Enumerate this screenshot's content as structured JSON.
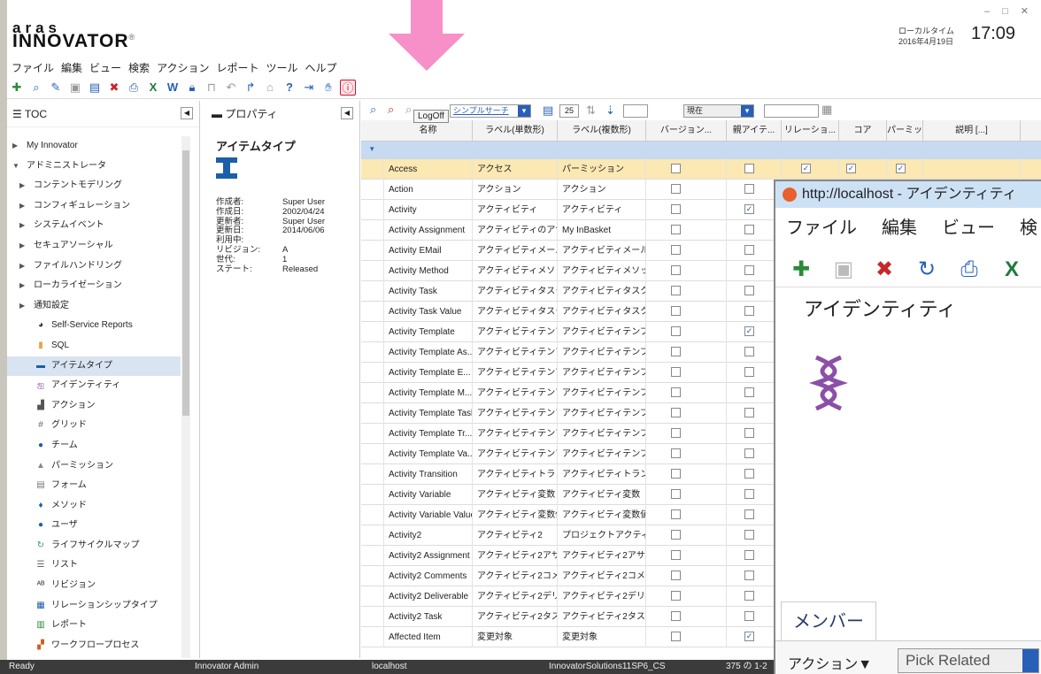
{
  "app": {
    "logo_top": "aras",
    "logo_main": "INNOVATOR",
    "logo_mark": "®",
    "local_time_label": "ローカルタイム",
    "date": "2016年4月19日",
    "time": "17:09",
    "window_controls": [
      "–",
      "□",
      "✕"
    ]
  },
  "menu": [
    "ファイル",
    "編集",
    "ビュー",
    "検索",
    "アクション",
    "レポート",
    "ツール",
    "ヘルプ"
  ],
  "tooltip": "LogOff",
  "toc": {
    "title": "TOC",
    "items": [
      {
        "label": "My Innovator",
        "level": 0,
        "caret": "▶"
      },
      {
        "label": "アドミニストレータ",
        "level": 0,
        "caret": "▼"
      },
      {
        "label": "コンテントモデリング",
        "level": 1,
        "caret": "▶"
      },
      {
        "label": "コンフィギュレーション",
        "level": 1,
        "caret": "▶"
      },
      {
        "label": "システムイベント",
        "level": 1,
        "caret": "▶"
      },
      {
        "label": "セキュアソーシャル",
        "level": 1,
        "caret": "▶"
      },
      {
        "label": "ファイルハンドリング",
        "level": 1,
        "caret": "▶"
      },
      {
        "label": "ローカライゼーション",
        "level": 1,
        "caret": "▶"
      },
      {
        "label": "通知設定",
        "level": 1,
        "caret": "▶"
      },
      {
        "label": "Self-Service Reports",
        "level": 2,
        "icon": "reports-icon",
        "glyph": "◕",
        "color": "#333"
      },
      {
        "label": "SQL",
        "level": 2,
        "icon": "sql-icon",
        "glyph": "▮",
        "color": "#e8a040"
      },
      {
        "label": "アイテムタイプ",
        "level": 2,
        "icon": "itemtype-icon",
        "glyph": "▬",
        "color": "#1b5fa8",
        "selected": true
      },
      {
        "label": "アイデンティティ",
        "level": 2,
        "icon": "dna-icon",
        "glyph": "ஐ",
        "color": "#8b4fa8"
      },
      {
        "label": "アクション",
        "level": 2,
        "icon": "action-icon",
        "glyph": "▟",
        "color": "#555"
      },
      {
        "label": "グリッド",
        "level": 2,
        "icon": "grid-icon",
        "glyph": "#",
        "color": "#666"
      },
      {
        "label": "チーム",
        "level": 2,
        "icon": "team-icon",
        "glyph": "●",
        "color": "#1b5fa8"
      },
      {
        "label": "パーミッション",
        "level": 2,
        "icon": "permission-icon",
        "glyph": "▲",
        "color": "#888"
      },
      {
        "label": "フォーム",
        "level": 2,
        "icon": "form-icon",
        "glyph": "▤",
        "color": "#777"
      },
      {
        "label": "メソッド",
        "level": 2,
        "icon": "method-icon",
        "glyph": "♦",
        "color": "#1b5fa8"
      },
      {
        "label": "ユーザ",
        "level": 2,
        "icon": "user-icon",
        "glyph": "●",
        "color": "#1b5fa8"
      },
      {
        "label": "ライフサイクルマップ",
        "level": 2,
        "icon": "lifecycle-icon",
        "glyph": "↻",
        "color": "#3a9a6a"
      },
      {
        "label": "リスト",
        "level": 2,
        "icon": "list-icon",
        "glyph": "☰",
        "color": "#666"
      },
      {
        "label": "リビジョン",
        "level": 2,
        "icon": "revision-icon",
        "glyph": "ᴬᴮ",
        "color": "#333"
      },
      {
        "label": "リレーションシップタイプ",
        "level": 2,
        "icon": "relationship-icon",
        "glyph": "▦",
        "color": "#1b5fa8"
      },
      {
        "label": "レポート",
        "level": 2,
        "icon": "report-icon",
        "glyph": "▥",
        "color": "#2a8a3a"
      },
      {
        "label": "ワークフロープロセス",
        "level": 2,
        "icon": "workflow-icon",
        "glyph": "▞",
        "color": "#d06020"
      }
    ]
  },
  "props": {
    "title": "プロパティ",
    "item_title": "アイテムタイプ",
    "fields": [
      {
        "k": "作成者:",
        "v": "Super User"
      },
      {
        "k": "作成日:",
        "v": "2002/04/24"
      },
      {
        "k": "更新者:",
        "v": "Super User"
      },
      {
        "k": "更新日:",
        "v": "2014/06/06"
      },
      {
        "k": "利用中:",
        "v": ""
      },
      {
        "k": "リビジョン:",
        "v": "A"
      },
      {
        "k": "世代:",
        "v": "1"
      },
      {
        "k": "ステート:",
        "v": "Released"
      }
    ]
  },
  "grid_tools": {
    "search_mode": "シンプルサーチ",
    "page_size": "25",
    "version_mode": "現在"
  },
  "columns": [
    "名称",
    "ラベル(単数形)",
    "ラベル(複数形)",
    "バージョン...",
    "親アイテ...",
    "リレーショ...",
    "コア",
    "パーミッショ...",
    "説明 [...]"
  ],
  "rows": [
    {
      "name": "Access",
      "single": "アクセス",
      "plural": "パーミッション",
      "c": [
        0,
        0,
        1,
        1,
        1
      ],
      "hl": true
    },
    {
      "name": "Action",
      "single": "アクション",
      "plural": "アクション",
      "c": [
        0,
        0,
        0,
        0,
        0
      ]
    },
    {
      "name": "Activity",
      "single": "アクティビティ",
      "plural": "アクティビティ",
      "c": [
        0,
        1,
        0,
        0,
        0
      ]
    },
    {
      "name": "Activity Assignment",
      "single": "アクティビティのアサ...",
      "plural": "My InBasket",
      "c": [
        0,
        0,
        0,
        0,
        0
      ]
    },
    {
      "name": "Activity EMail",
      "single": "アクティビティメール",
      "plural": "アクティビティメール",
      "c": [
        0,
        0,
        0,
        0,
        0
      ]
    },
    {
      "name": "Activity Method",
      "single": "アクティビティメソッド",
      "plural": "アクティビティメソッド",
      "c": [
        0,
        0,
        0,
        0,
        0
      ]
    },
    {
      "name": "Activity Task",
      "single": "アクティビティタスク",
      "plural": "アクティビティタスク",
      "c": [
        0,
        0,
        0,
        0,
        0
      ]
    },
    {
      "name": "Activity Task Value",
      "single": "アクティビティタスクバ...",
      "plural": "アクティビティタスクバ...",
      "c": [
        0,
        0,
        0,
        0,
        0
      ]
    },
    {
      "name": "Activity Template",
      "single": "アクティビティテンプレ...",
      "plural": "アクティビティテンプレ...",
      "c": [
        0,
        1,
        0,
        0,
        0
      ]
    },
    {
      "name": "Activity Template As...",
      "single": "アクティビティテンプレ...",
      "plural": "アクティビティテンプレ...",
      "c": [
        0,
        0,
        0,
        0,
        0
      ]
    },
    {
      "name": "Activity Template E...",
      "single": "アクティビティテンプレ...",
      "plural": "アクティビティテンプレ...",
      "c": [
        0,
        0,
        0,
        0,
        0
      ]
    },
    {
      "name": "Activity Template M...",
      "single": "アクティビティテンプレ...",
      "plural": "アクティビティテンプレ...",
      "c": [
        0,
        0,
        0,
        0,
        0
      ]
    },
    {
      "name": "Activity Template Task",
      "single": "アクティビティテンプレ...",
      "plural": "アクティビティテンプレ...",
      "c": [
        0,
        0,
        0,
        0,
        0
      ]
    },
    {
      "name": "Activity Template Tr...",
      "single": "アクティビティテンプレ...",
      "plural": "アクティビティテンプレ...",
      "c": [
        0,
        0,
        0,
        0,
        0
      ]
    },
    {
      "name": "Activity Template Va...",
      "single": "アクティビティテンプレ...",
      "plural": "アクティビティテンプレ...",
      "c": [
        0,
        0,
        0,
        0,
        0
      ]
    },
    {
      "name": "Activity Transition",
      "single": "アクティビティトランジ...",
      "plural": "アクティビティトランジ...",
      "c": [
        0,
        0,
        0,
        0,
        0
      ]
    },
    {
      "name": "Activity Variable",
      "single": "アクティビティ変数",
      "plural": "アクティビティ変数",
      "c": [
        0,
        0,
        0,
        0,
        0
      ]
    },
    {
      "name": "Activity Variable Value",
      "single": "アクティビティ変数値",
      "plural": "アクティビティ変数値",
      "c": [
        0,
        0,
        0,
        0,
        0
      ]
    },
    {
      "name": "Activity2",
      "single": "アクティビティ2",
      "plural": "プロジェクトアクティビ...",
      "c": [
        0,
        0,
        0,
        0,
        0
      ]
    },
    {
      "name": "Activity2 Assignment",
      "single": "アクティビティ2アサイ...",
      "plural": "アクティビティ2アサイ...",
      "c": [
        0,
        0,
        0,
        0,
        0
      ]
    },
    {
      "name": "Activity2 Comments",
      "single": "アクティビティ2コメント",
      "plural": "アクティビティ2コメント",
      "c": [
        0,
        0,
        0,
        0,
        0
      ]
    },
    {
      "name": "Activity2 Deliverable",
      "single": "アクティビティ2デリバ...",
      "plural": "アクティビティ2デリバ...",
      "c": [
        0,
        0,
        0,
        0,
        0
      ]
    },
    {
      "name": "Activity2 Task",
      "single": "アクティビティ2タスク",
      "plural": "アクティビティ2タスク",
      "c": [
        0,
        0,
        0,
        0,
        0
      ]
    },
    {
      "name": "Affected Item",
      "single": "変更対象",
      "plural": "変更対象",
      "c": [
        0,
        1,
        0,
        0,
        0
      ]
    }
  ],
  "popup": {
    "title": "http://localhost - アイデンティティ",
    "menu": [
      "ファイル",
      "編集",
      "ビュー",
      "検"
    ],
    "heading": "アイデンティティ",
    "tab": "メンバー",
    "action_label": "アクション▼",
    "pick": "Pick Related"
  },
  "status": {
    "ready": "Ready",
    "user": "Innovator Admin",
    "host": "localhost",
    "db": "InnovatorSolutions11SP6_CS",
    "count": "375 の 1-2"
  }
}
